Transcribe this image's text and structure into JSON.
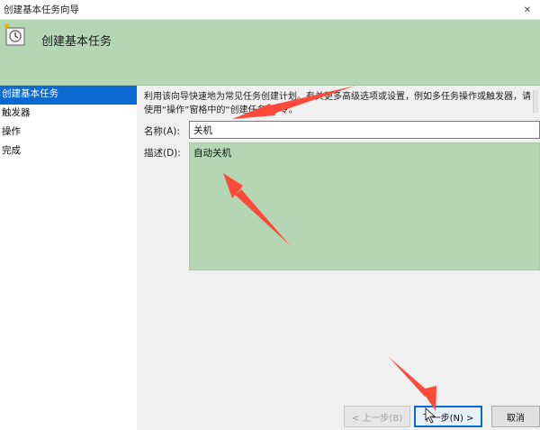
{
  "window": {
    "title": "创建基本任务向导",
    "close_label": "✕"
  },
  "header": {
    "heading": "创建基本任务"
  },
  "sidebar": {
    "items": [
      {
        "label": "创建基本任务",
        "active": true
      },
      {
        "label": "触发器",
        "active": false
      },
      {
        "label": "操作",
        "active": false
      },
      {
        "label": "完成",
        "active": false
      }
    ]
  },
  "content": {
    "intro": "利用该向导快速地为常见任务创建计划。有关更多高级选项或设置，例如多任务操作或触发器，请使用“操作”窗格中的“创建任务”命令。",
    "name_label": "名称(A):",
    "name_value": "关机",
    "desc_label": "描述(D):",
    "desc_value": "自动关机"
  },
  "buttons": {
    "back": "< 上一步(B)",
    "next": "下一步(N) >",
    "cancel": "取消"
  },
  "colors": {
    "header_bg": "#b4d6b4",
    "selection": "#0b6ad2",
    "annotation_arrow": "#ff4a3a"
  }
}
